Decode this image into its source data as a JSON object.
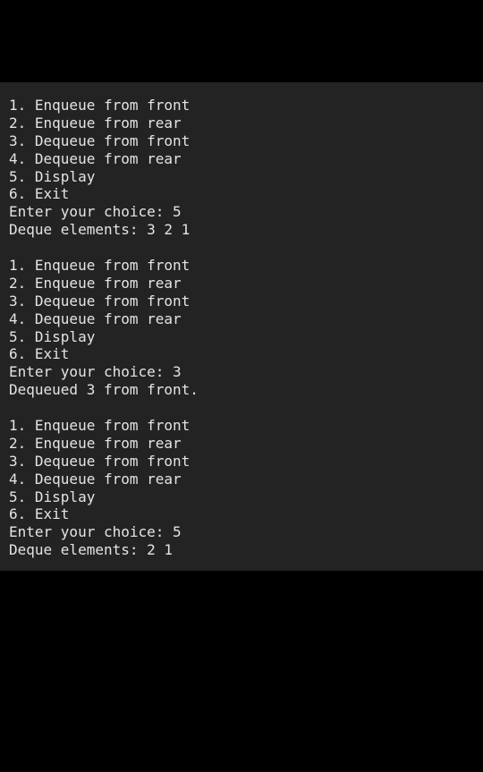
{
  "terminal": {
    "blocks": [
      {
        "menu": [
          "1. Enqueue from front",
          "2. Enqueue from rear",
          "3. Dequeue from front",
          "4. Dequeue from rear",
          "5. Display",
          "6. Exit"
        ],
        "prompt": "Enter your choice: 5",
        "result": "Deque elements: 3 2 1"
      },
      {
        "menu": [
          "1. Enqueue from front",
          "2. Enqueue from rear",
          "3. Dequeue from front",
          "4. Dequeue from rear",
          "5. Display",
          "6. Exit"
        ],
        "prompt": "Enter your choice: 3",
        "result": "Dequeued 3 from front."
      },
      {
        "menu": [
          "1. Enqueue from front",
          "2. Enqueue from rear",
          "3. Dequeue from front",
          "4. Dequeue from rear",
          "5. Display",
          "6. Exit"
        ],
        "prompt": "Enter your choice: 5",
        "result": "Deque elements: 2 1"
      }
    ]
  },
  "colors": {
    "background": "#000000",
    "terminal_background": "#232323",
    "text": "#e4e4e4"
  }
}
